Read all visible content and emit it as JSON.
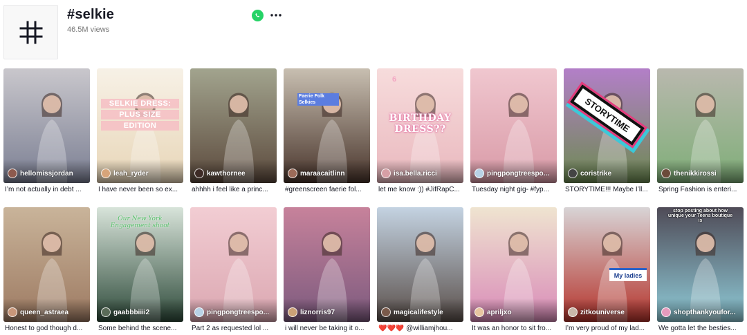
{
  "header": {
    "title": "#selkie",
    "views": "46.5M views",
    "tag_icon": "hashtag-icon",
    "share_icon": "whatsapp-icon",
    "more_icon": "more-icon"
  },
  "videos": [
    {
      "author": "hellomissjordan",
      "caption": "I’m not actually in debt ...",
      "colors": [
        "#c9c7cc",
        "#7b7f93"
      ],
      "avatar": "#8d5a4e"
    },
    {
      "author": "leah_ryder",
      "caption": "I have never been so ex...",
      "colors": [
        "#f7f1e6",
        "#e8d6b8"
      ],
      "avatar": "#d7a47a",
      "overlay": {
        "line1": "SELKIE DRESS:",
        "line2": "PLUS SIZE",
        "line3": "EDITION"
      }
    },
    {
      "author": "kawthornee",
      "caption": "ahhhh i feel like a princ...",
      "colors": [
        "#a2a48e",
        "#5c4a3d"
      ],
      "avatar": "#3e2b26"
    },
    {
      "author": "maraacaitlinn",
      "caption": "#greenscreen faerie fol...",
      "colors": [
        "#c8bfb1",
        "#49352c"
      ],
      "avatar": "#9c6b59",
      "overlay": {
        "line1": "Faerie Folk",
        "line2": "Selkies"
      }
    },
    {
      "author": "isa.bella.ricci",
      "caption": "let me know :)) #JifRapC...",
      "colors": [
        "#f7dcdc",
        "#e9b8be"
      ],
      "avatar": "#d79fa5",
      "overlay": {
        "line1": "6",
        "line2": "BIRTHDAY",
        "line3": "DRESS??"
      }
    },
    {
      "author": "pingpongtreespo...",
      "caption": "Tuesday night gig- #fyp...",
      "colors": [
        "#f0c7cf",
        "#d99aa7"
      ],
      "avatar": "#b8d2e6"
    },
    {
      "author": "coristrike",
      "caption": "STORYTIME!!! Maybe I’ll...",
      "colors": [
        "#b37fc8",
        "#6d8a52"
      ],
      "avatar": "#444444",
      "overlay": {
        "line1": "STORYTIME"
      }
    },
    {
      "author": "thenikkirossi",
      "caption": "Spring Fashion is enteri...",
      "colors": [
        "#b9b8ae",
        "#7fae78"
      ],
      "avatar": "#6b4b3a"
    },
    {
      "author": "queen_astraea",
      "caption": "Honest to god though d...",
      "colors": [
        "#c9b49a",
        "#9d7a62"
      ],
      "avatar": "#c9977a"
    },
    {
      "author": "gaabbbiiii2",
      "caption": "Some behind the scene...",
      "colors": [
        "#d8e4da",
        "#2f4b3b"
      ],
      "avatar": "#5a6b58",
      "overlay": {
        "line1": "Our New York",
        "line2": "Engagement shoot"
      }
    },
    {
      "author": "pingpongtreespo...",
      "caption": "Part 2 as requested lol ...",
      "colors": [
        "#f2cdd3",
        "#dba7b1"
      ],
      "avatar": "#b8d2e6"
    },
    {
      "author": "liznorris97",
      "caption": "i will never be taking it o...",
      "colors": [
        "#c7829b",
        "#7c5a7e"
      ],
      "avatar": "#caa176"
    },
    {
      "author": "magicalifestyle",
      "caption": "❤️❤️❤️ @williamjhou...",
      "colors": [
        "#c4d3e2",
        "#5a4f4a"
      ],
      "avatar": "#7a5a4a"
    },
    {
      "author": "apriljxo",
      "caption": "It was an honor to sit fro...",
      "colors": [
        "#efe4d0",
        "#d98bb8"
      ],
      "avatar": "#e8c6a0"
    },
    {
      "author": "zitkouniverse",
      "caption": "I’m very proud of my lad...",
      "colors": [
        "#d8d4d6",
        "#b5342c"
      ],
      "avatar": "#c9b7a9",
      "overlay": {
        "line1": "My ladies"
      }
    },
    {
      "author": "shopthankyoufor...",
      "caption": "We gotta let the besties...",
      "colors": [
        "#4f4b57",
        "#8fcbd8"
      ],
      "avatar": "#e69bbd",
      "overlay": {
        "line1": "stop posting about how",
        "line2": "unique your Teens boutique",
        "line3": "is"
      }
    }
  ]
}
